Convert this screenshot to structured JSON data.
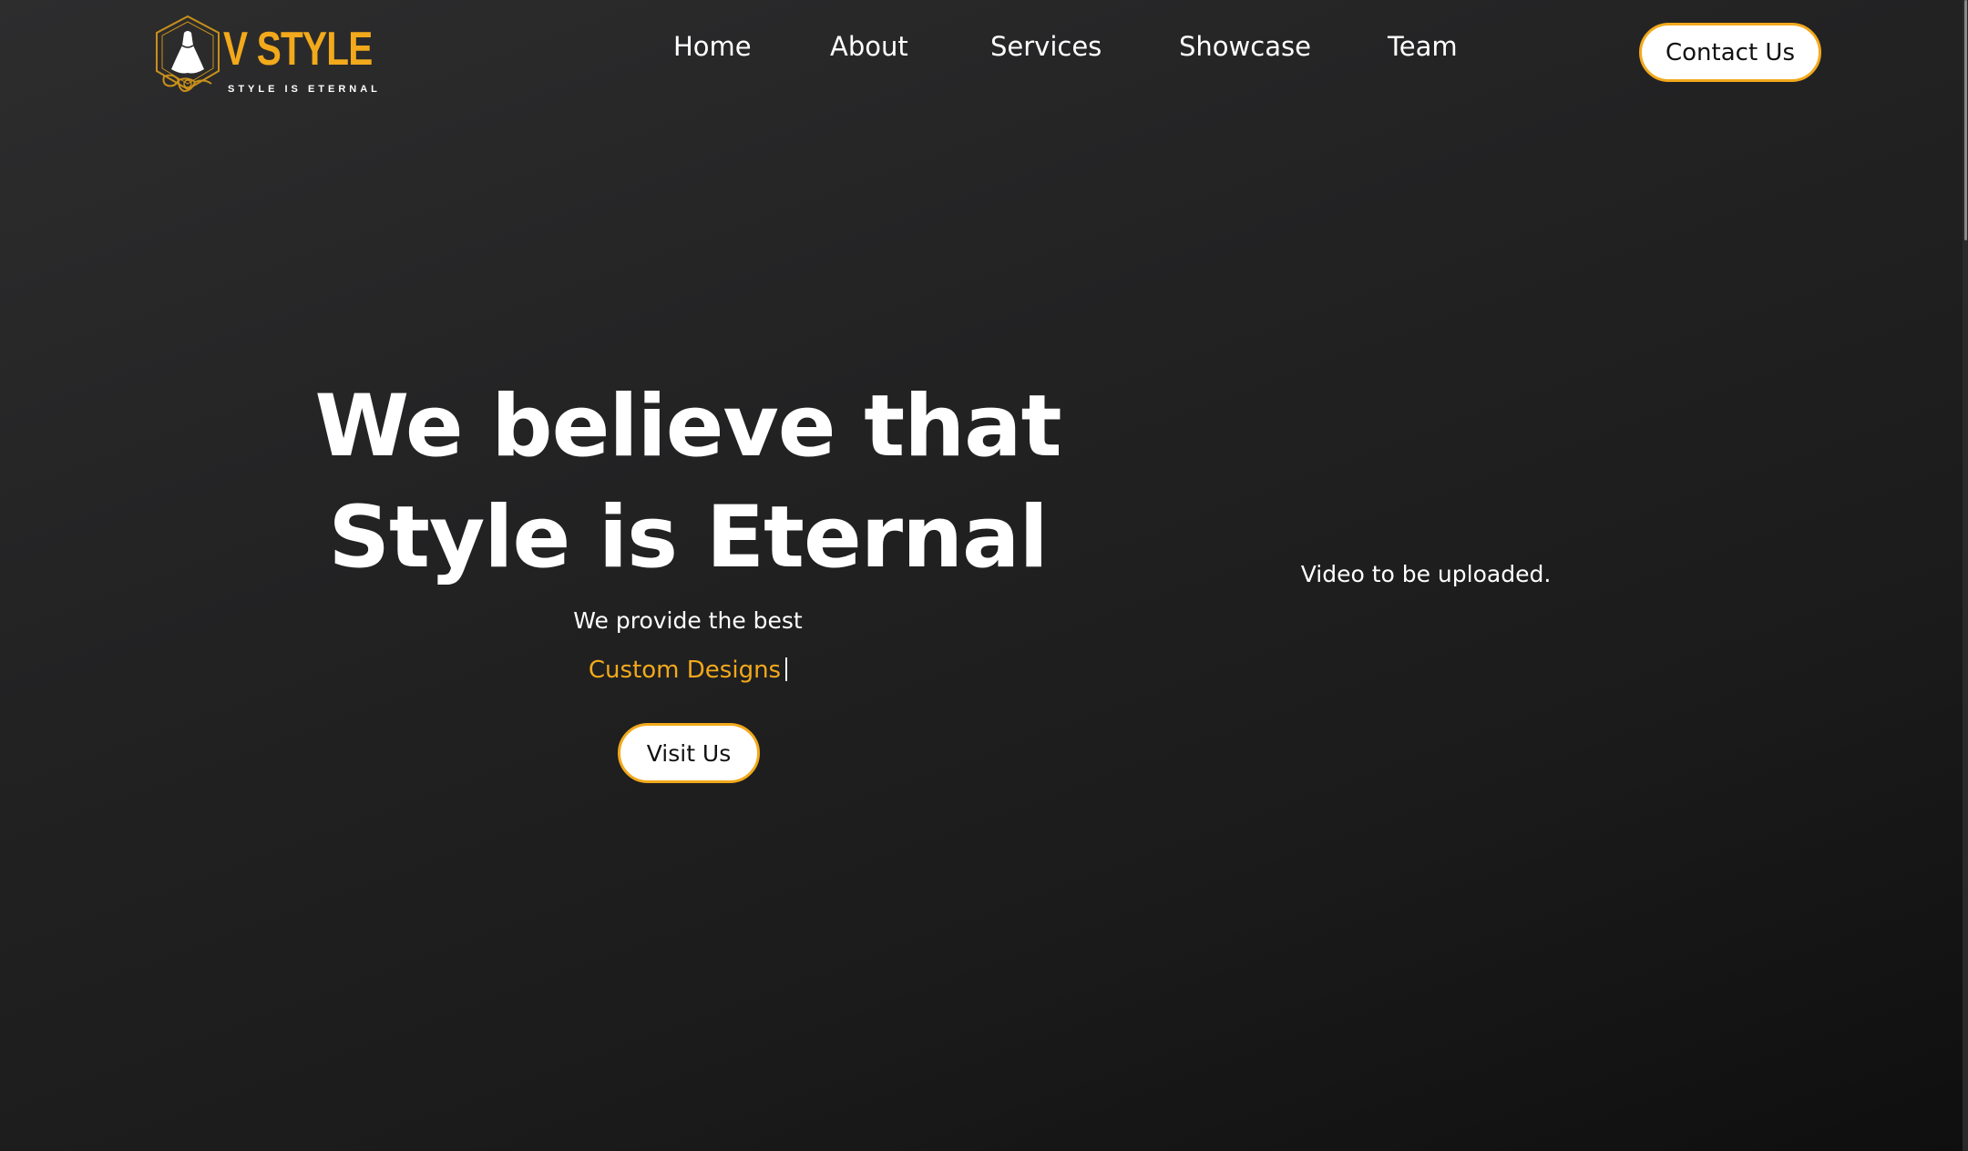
{
  "brand": {
    "name": "V STYLE",
    "tagline": "STYLE IS ETERNAL",
    "logo_icon": "dress-hexagon-logo-icon",
    "accent_color": "#f2a91b"
  },
  "nav": {
    "items": [
      {
        "label": "Home"
      },
      {
        "label": "About"
      },
      {
        "label": "Services"
      },
      {
        "label": "Showcase"
      },
      {
        "label": "Team"
      }
    ],
    "contact_label": "Contact Us"
  },
  "hero": {
    "title_line1": "We believe that",
    "title_line2": "Style is Eternal",
    "subtitle": "We provide the best",
    "typed_text": "Custom Designs",
    "cta_label": "Visit Us"
  },
  "video": {
    "placeholder_text": "Video to be uploaded."
  }
}
